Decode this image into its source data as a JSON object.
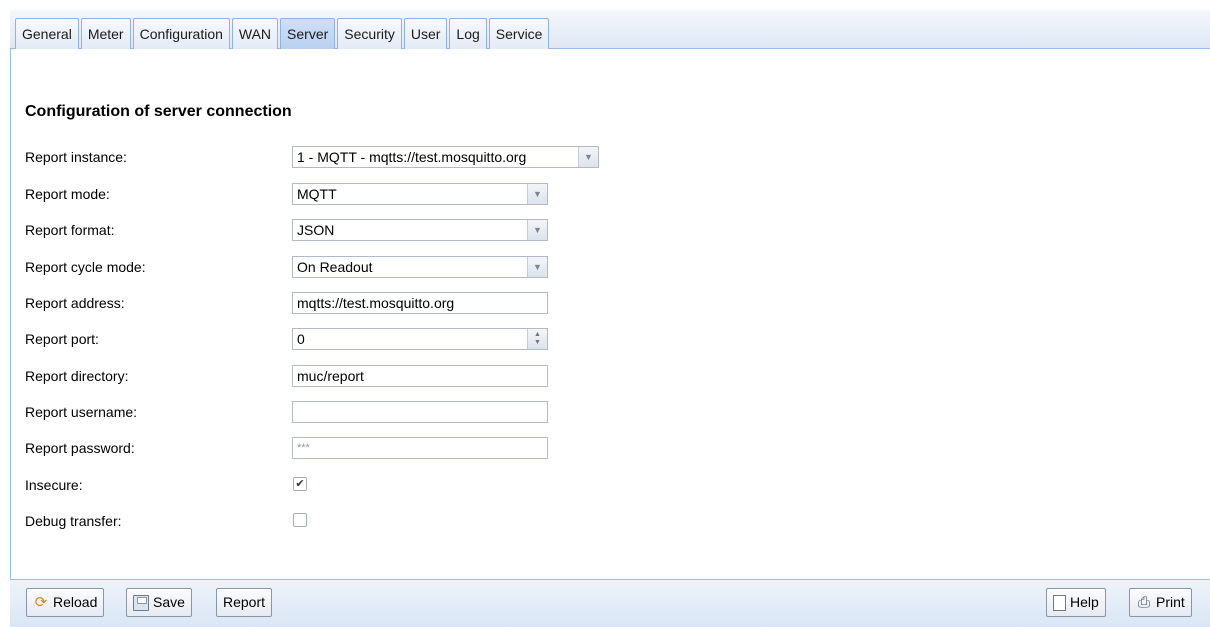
{
  "tabs": [
    {
      "label": "General"
    },
    {
      "label": "Meter"
    },
    {
      "label": "Configuration"
    },
    {
      "label": "WAN"
    },
    {
      "label": "Server",
      "active": true
    },
    {
      "label": "Security"
    },
    {
      "label": "User"
    },
    {
      "label": "Log"
    },
    {
      "label": "Service"
    }
  ],
  "section": {
    "title": "Configuration of server connection"
  },
  "form": {
    "report_instance": {
      "label": "Report instance:",
      "value": "1 - MQTT - mqtts://test.mosquitto.org"
    },
    "report_mode": {
      "label": "Report mode:",
      "value": "MQTT"
    },
    "report_format": {
      "label": "Report format:",
      "value": "JSON"
    },
    "report_cycle_mode": {
      "label": "Report cycle mode:",
      "value": "On Readout"
    },
    "report_address": {
      "label": "Report address:",
      "value": "mqtts://test.mosquitto.org"
    },
    "report_port": {
      "label": "Report port:",
      "value": "0"
    },
    "report_directory": {
      "label": "Report directory:",
      "value": "muc/report"
    },
    "report_username": {
      "label": "Report username:",
      "value": ""
    },
    "report_password": {
      "label": "Report password:",
      "value": "***"
    },
    "insecure": {
      "label": "Insecure:",
      "checked": true,
      "mark": "✔"
    },
    "debug_transfer": {
      "label": "Debug transfer:",
      "checked": false
    }
  },
  "toolbar": {
    "reload_label": "Reload",
    "save_label": "Save",
    "report_label": "Report",
    "help_label": "Help",
    "print_label": "Print"
  },
  "colors": {
    "tab_active": "#b9d0f0",
    "border": "#99bbe8",
    "footer_bg": "#dae6f5"
  }
}
